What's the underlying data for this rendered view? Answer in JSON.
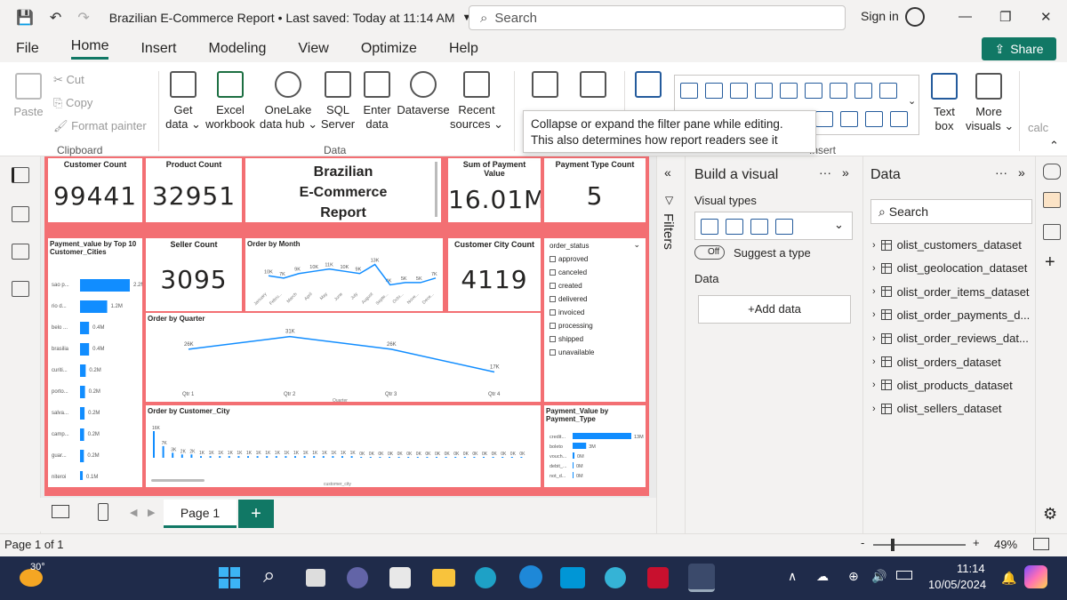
{
  "titlebar": {
    "title": "Brazilian E-Commerce Report • Last saved: Today at 11:14 AM",
    "search_placeholder": "Search",
    "signin": "Sign in"
  },
  "menu": {
    "items": [
      "File",
      "Home",
      "Insert",
      "Modeling",
      "View",
      "Optimize",
      "Help"
    ],
    "active": "Home",
    "share": "Share"
  },
  "ribbon": {
    "clipboard": {
      "paste": "Paste",
      "cut": "Cut",
      "copy": "Copy",
      "format_painter": "Format painter",
      "group": "Clipboard"
    },
    "data": {
      "get_data": "Get\ndata ⌄",
      "excel": "Excel\nworkbook",
      "onelake": "OneLake\ndata hub ⌄",
      "sql": "SQL\nServer",
      "enter": "Enter\ndata",
      "dataverse": "Dataverse",
      "recent": "Recent\nsources ⌄",
      "group": "Data"
    },
    "insert": {
      "text_box": "Text\nbox",
      "more_visuals": "More\nvisuals ⌄",
      "group": "Insert"
    },
    "calc_partial": "calc"
  },
  "tooltip": "Collapse or expand the filter pane while editing. This also determines how report readers see it",
  "report": {
    "customer_count": {
      "title": "Customer Count",
      "value": "99441"
    },
    "product_count": {
      "title": "Product Count",
      "value": "32951"
    },
    "report_title": {
      "line1": "Brazilian",
      "line2": "E-Commerce",
      "line3": "Report"
    },
    "sum_payment": {
      "title": "Sum of Payment Value",
      "value": "16.01M"
    },
    "payment_type_count": {
      "title": "Payment Type Count",
      "value": "5"
    },
    "seller_count": {
      "title": "Seller Count",
      "value": "3095"
    },
    "customer_city_count": {
      "title": "Customer City Count",
      "value": "4119"
    },
    "order_status": {
      "title": "order_status",
      "items": [
        "approved",
        "canceled",
        "created",
        "delivered",
        "invoiced",
        "processing",
        "shipped",
        "unavailable"
      ]
    },
    "payment_by_city": {
      "title": "Payment_value by Top 10 Customer_Cities",
      "categories": [
        "sao p...",
        "rio d...",
        "belo ...",
        "brasilia",
        "curiti...",
        "porto...",
        "salva...",
        "camp...",
        "guar...",
        "niteroi"
      ],
      "labels": [
        "2.2M",
        "1.2M",
        "0.4M",
        "0.4M",
        "0.2M",
        "0.2M",
        "0.2M",
        "0.2M",
        "0.2M",
        "0.1M"
      ],
      "values": [
        2.2,
        1.2,
        0.4,
        0.4,
        0.25,
        0.22,
        0.2,
        0.18,
        0.17,
        0.12
      ]
    },
    "order_by_month": {
      "title": "Order by Month",
      "months": [
        "January",
        "Febru...",
        "March",
        "April",
        "May",
        "June",
        "July",
        "August",
        "Septe...",
        "Octo...",
        "Nove...",
        "Dece..."
      ],
      "labels": [
        "10K",
        "7K",
        "9K",
        "10K",
        "11K",
        "10K",
        "9K",
        "13K",
        "4K",
        "5K",
        "5K",
        "7K"
      ],
      "values": [
        8,
        7,
        9,
        10,
        11,
        10,
        9,
        13,
        4,
        5,
        5,
        7
      ]
    },
    "order_by_quarter": {
      "title": "Order by Quarter",
      "categories": [
        "Qtr 1",
        "Qtr 2",
        "Qtr 3",
        "Qtr 4"
      ],
      "labels": [
        "26K",
        "31K",
        "26K",
        "17K"
      ],
      "values": [
        26,
        31,
        26,
        17
      ],
      "xlabel": "Quarter"
    },
    "order_by_city": {
      "title": "Order by Customer_City",
      "labels": [
        "16K",
        "7K",
        "3K",
        "2K",
        "2K",
        "1K",
        "1K",
        "1K",
        "1K",
        "1K",
        "1K",
        "1K",
        "1K",
        "1K",
        "1K",
        "1K",
        "1K",
        "1K",
        "1K",
        "1K",
        "1K",
        "1K",
        "0K",
        "0K",
        "0K",
        "0K",
        "0K",
        "0K",
        "0K",
        "0K",
        "0K",
        "0K",
        "0K",
        "0K",
        "0K",
        "0K",
        "0K",
        "0K",
        "0K",
        "0K"
      ],
      "xlabel": "customer_city"
    },
    "payment_by_type": {
      "title": "Payment_Value by Payment_Type",
      "categories": [
        "credit...",
        "boleto",
        "vouch...",
        "debit_...",
        "not_d..."
      ],
      "labels": [
        "13M",
        "3M",
        "0M",
        "0M",
        "0M"
      ],
      "values": [
        13,
        3,
        0.4,
        0.2,
        0
      ]
    }
  },
  "filters_label": "Filters",
  "build": {
    "title": "Build a visual",
    "visual_types": "Visual types",
    "toggle": "Off",
    "suggest": "Suggest a type",
    "data": "Data",
    "add_data": "+Add data"
  },
  "datapane": {
    "title": "Data",
    "search": "Search",
    "tables": [
      "olist_customers_dataset",
      "olist_geolocation_dataset",
      "olist_order_items_dataset",
      "olist_order_payments_d...",
      "olist_order_reviews_dat...",
      "olist_orders_dataset",
      "olist_products_dataset",
      "olist_sellers_dataset"
    ]
  },
  "pages": {
    "tab": "Page 1",
    "add": "+"
  },
  "status": {
    "page": "Page 1 of 1",
    "zoom": "49%",
    "minus": "-",
    "plus": "+"
  },
  "taskbar": {
    "temp": "30°",
    "time": "11:14",
    "date": "10/05/2024"
  },
  "colors": {
    "accent": "#117865",
    "canvas": "#f36f73",
    "bar": "#118dff",
    "taskbar": "#1f2b4a"
  }
}
